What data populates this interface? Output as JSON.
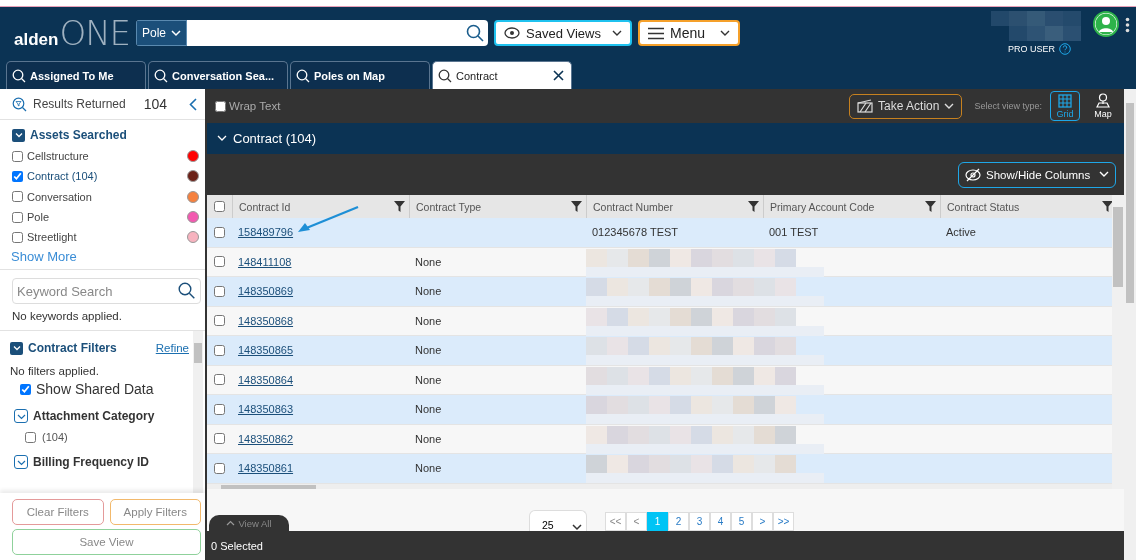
{
  "header": {
    "logo": {
      "prefix": "alden",
      "suffix": "ONE"
    },
    "search": {
      "type": "Pole"
    },
    "saved_views": "Saved Views",
    "menu": "Menu",
    "user_role": "PRO USER"
  },
  "tabs": [
    {
      "label": "Assigned To Me",
      "selected": false
    },
    {
      "label": "Conversation Sea...",
      "selected": false
    },
    {
      "label": "Poles on Map",
      "selected": false
    },
    {
      "label": "Contract",
      "selected": true
    }
  ],
  "sidebar": {
    "results_label": "Results Returned",
    "results_count": "104",
    "assets": {
      "title": "Assets Searched",
      "expanded": true,
      "items": [
        {
          "label": "Cellstructure",
          "checked": false,
          "color": "#ff0000"
        },
        {
          "label": "Contract (104)",
          "checked": true,
          "color": "#6b2118"
        },
        {
          "label": "Conversation",
          "checked": false,
          "color": "#f5813f"
        },
        {
          "label": "Pole",
          "checked": false,
          "color": "#f25ab0"
        },
        {
          "label": "Streetlight",
          "checked": false,
          "color": "#f7b3bf"
        }
      ],
      "show_more": "Show More"
    },
    "keyword": {
      "placeholder": "Keyword Search",
      "note": "No keywords applied."
    },
    "filters": {
      "title": "Contract Filters",
      "expanded": true,
      "refine": "Refine",
      "note": "No filters applied.",
      "show_shared": {
        "label": "Show Shared Data",
        "checked": true
      },
      "groups": [
        {
          "title": "Attachment Category",
          "expanded": true,
          "options": [
            {
              "label": "(104)",
              "checked": false
            }
          ]
        },
        {
          "title": "Billing Frequency ID",
          "expanded": true
        }
      ]
    },
    "buttons": {
      "clear": "Clear Filters",
      "apply": "Apply Filters",
      "save": "Save View"
    }
  },
  "toolbar": {
    "wrap_text": {
      "label": "Wrap Text",
      "checked": false
    },
    "take_action": "Take Action",
    "view_type_label": "Select view type:",
    "view_types": [
      {
        "label": "Grid",
        "selected": true,
        "kind": "grid"
      },
      {
        "label": "Map",
        "selected": false,
        "kind": "map"
      }
    ]
  },
  "group": {
    "title": "Contract (104)",
    "expanded": true
  },
  "show_hide": "Show/Hide Columns",
  "table": {
    "select_all_checked": false,
    "columns": [
      "Contract Id",
      "Contract Type",
      "Contract Number",
      "Primary Account Code",
      "Contract Status"
    ],
    "rows": [
      {
        "contract_id": "158489796",
        "contract_number": "012345678 TEST",
        "primary_account_code": "001 TEST",
        "contract_status": "Active",
        "checked": false,
        "redacted": false
      },
      {
        "contract_id": "148411108",
        "contract_type": "None",
        "checked": false,
        "redacted": true
      },
      {
        "contract_id": "148350869",
        "contract_type": "None",
        "checked": false,
        "redacted": true
      },
      {
        "contract_id": "148350868",
        "contract_type": "None",
        "checked": false,
        "redacted": true
      },
      {
        "contract_id": "148350865",
        "contract_type": "None",
        "checked": false,
        "redacted": true
      },
      {
        "contract_id": "148350864",
        "contract_type": "None",
        "checked": false,
        "redacted": true
      },
      {
        "contract_id": "148350863",
        "contract_type": "None",
        "checked": false,
        "redacted": true
      },
      {
        "contract_id": "148350862",
        "contract_type": "None",
        "checked": false,
        "redacted": true
      },
      {
        "contract_id": "148350861",
        "contract_type": "None",
        "checked": false,
        "redacted": true
      }
    ]
  },
  "pagination": {
    "page_size": "25",
    "first": "<<",
    "prev": "<",
    "pages": [
      {
        "label": "1",
        "selected": true
      },
      {
        "label": "2",
        "selected": false
      },
      {
        "label": "3",
        "selected": false
      },
      {
        "label": "4",
        "selected": false
      },
      {
        "label": "5",
        "selected": false
      }
    ],
    "next": ">",
    "last": ">>"
  },
  "view_all": "View All",
  "status": "0 Selected"
}
